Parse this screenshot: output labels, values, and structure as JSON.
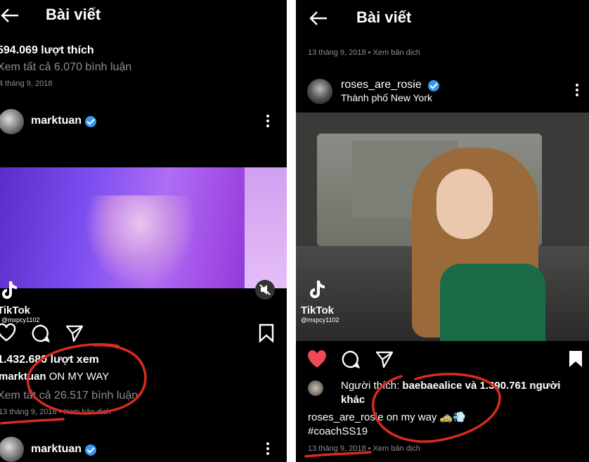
{
  "left": {
    "header_title": "Bài viết",
    "prev_post": {
      "likes": "594.069 lượt thích",
      "comments_link": "Xem tất cả 6.070 bình luận",
      "date": "4 tháng 9, 2018"
    },
    "post": {
      "username": "marktuan",
      "tiktok_label": "TikTok",
      "tiktok_handle": "@mxpcy1102",
      "views": "1.432.680 lượt xem",
      "caption_user": "marktuan",
      "caption_text": "ON MY WAY",
      "comments_link": "Xem tất cả 26.517 bình luận",
      "date": "13 tháng 9, 2018",
      "translate": "Xem bản dịch"
    },
    "next_post_username": "marktuan"
  },
  "right": {
    "header_title": "Bài viết",
    "prev_post": {
      "date": "13 tháng 9, 2018",
      "translate": "Xem bản dịch"
    },
    "post": {
      "username": "roses_are_rosie",
      "location": "Thành phố New York",
      "tiktok_label": "TikTok",
      "tiktok_handle": "@mxpcy1102",
      "liked_by_prefix": "Người thích:",
      "liked_by_user": "baebaealice",
      "liked_by_suffix": "và 1.390.761 người khác",
      "caption_user": "roses_are_rosie",
      "caption_text": "on my way 🚕💨",
      "hashtag": "#coachSS19",
      "date": "13 tháng 9, 2018",
      "translate": "Xem bản dịch"
    }
  },
  "colors": {
    "background": "#000000",
    "verified": "#3897f0",
    "like_active": "#ed4956",
    "annotation": "#d92b1f"
  }
}
